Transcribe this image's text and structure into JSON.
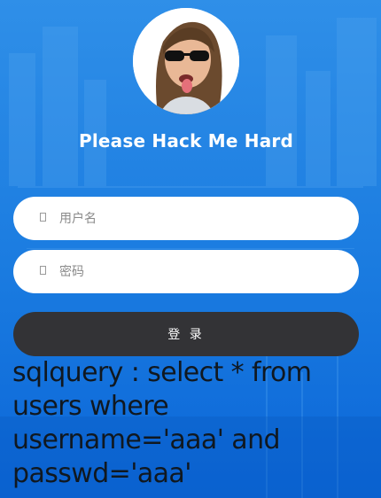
{
  "colors": {
    "background": "#1e7fe0",
    "button": "#333336",
    "field": "#ffffff",
    "title": "#ffffff",
    "query_text": "#101820"
  },
  "avatar": {
    "alt": "avatar photo of a person with sunglasses sticking out tongue"
  },
  "title": "Please Hack Me Hard",
  "form": {
    "username_placeholder": "用户名",
    "username_value": "",
    "password_placeholder": "密码",
    "password_value": "",
    "username_icon": "user-icon",
    "password_icon": "lock-icon",
    "submit_label": "登 录"
  },
  "sqlquery": "sqlquery : select * from users where username='aaa' and passwd='aaa'"
}
